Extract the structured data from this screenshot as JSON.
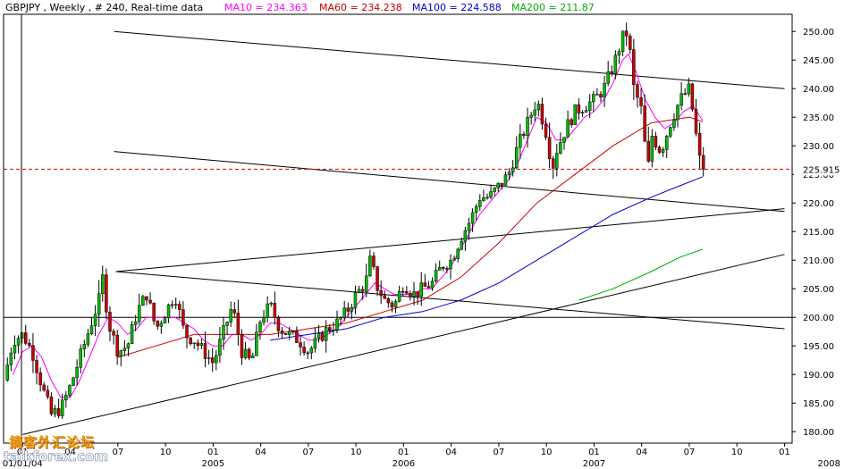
{
  "header": {
    "symbol_info": "GBPJPY , Weekly , # 240, Real-time data",
    "ma10": "MA10 = 234.363",
    "ma60": "MA60 = 234.238",
    "ma100": "MA100 = 224.588",
    "ma200": "MA200 = 211.87"
  },
  "last_price_label": "225.915",
  "watermark": {
    "chinese": "摘客外汇论坛",
    "english": "taikforex.com"
  },
  "colors": {
    "ma10": "#ff00ff",
    "ma60": "#cc0000",
    "ma100": "#0000cc",
    "ma200": "#00aa00",
    "bull_candle": "#00bb00",
    "bear_candle": "#cc0000",
    "last_price": "#dd0000"
  },
  "chart_data": {
    "type": "candlestick",
    "title": "GBPJPY , Weekly , # 240, Real-time data",
    "ylim": [
      178,
      253
    ],
    "y_ticks": [
      180,
      185,
      190,
      195,
      200,
      205,
      210,
      215,
      220,
      225,
      230,
      235,
      240,
      245,
      250
    ],
    "x_tick_labels": [
      "01",
      "04",
      "07",
      "10",
      "01",
      "04",
      "07",
      "10",
      "01",
      "04",
      "07",
      "10",
      "01",
      "04",
      "07",
      "10",
      "01"
    ],
    "year_labels": [
      "01/01/04",
      "2005",
      "2006",
      "2007",
      "2008"
    ],
    "horizontal_lines": [
      {
        "value": 200.0,
        "style": "solid"
      },
      {
        "value": 225.915,
        "style": "dashed",
        "label": "225.915"
      }
    ],
    "anchors": [
      [
        2003.92,
        189
      ],
      [
        2003.97,
        196
      ],
      [
        2004.02,
        197
      ],
      [
        2004.07,
        194
      ],
      [
        2004.12,
        188
      ],
      [
        2004.17,
        183
      ],
      [
        2004.22,
        184
      ],
      [
        2004.27,
        188
      ],
      [
        2004.32,
        193
      ],
      [
        2004.37,
        198
      ],
      [
        2004.42,
        203
      ],
      [
        2004.44,
        207
      ],
      [
        2004.47,
        199
      ],
      [
        2004.52,
        194
      ],
      [
        2004.57,
        195
      ],
      [
        2004.62,
        201
      ],
      [
        2004.67,
        204
      ],
      [
        2004.72,
        198
      ],
      [
        2004.77,
        201
      ],
      [
        2004.82,
        204
      ],
      [
        2004.87,
        197
      ],
      [
        2004.92,
        196
      ],
      [
        2004.97,
        194
      ],
      [
        2005.02,
        192
      ],
      [
        2005.07,
        197
      ],
      [
        2005.12,
        202
      ],
      [
        2005.17,
        194
      ],
      [
        2005.22,
        192
      ],
      [
        2005.27,
        200
      ],
      [
        2005.32,
        202
      ],
      [
        2005.37,
        198
      ],
      [
        2005.42,
        197
      ],
      [
        2005.47,
        196
      ],
      [
        2005.52,
        194
      ],
      [
        2005.57,
        196
      ],
      [
        2005.62,
        198
      ],
      [
        2005.67,
        199
      ],
      [
        2005.72,
        201
      ],
      [
        2005.77,
        204
      ],
      [
        2005.82,
        206
      ],
      [
        2005.85,
        211
      ],
      [
        2005.87,
        206
      ],
      [
        2005.92,
        203
      ],
      [
        2005.97,
        202
      ],
      [
        2006.02,
        206
      ],
      [
        2006.07,
        204
      ],
      [
        2006.12,
        205
      ],
      [
        2006.17,
        206
      ],
      [
        2006.22,
        209
      ],
      [
        2006.27,
        210
      ],
      [
        2006.32,
        214
      ],
      [
        2006.37,
        217
      ],
      [
        2006.42,
        221
      ],
      [
        2006.47,
        221
      ],
      [
        2006.52,
        223
      ],
      [
        2006.57,
        225
      ],
      [
        2006.62,
        230
      ],
      [
        2006.67,
        234
      ],
      [
        2006.72,
        238
      ],
      [
        2006.77,
        232
      ],
      [
        2006.8,
        226
      ],
      [
        2006.82,
        229
      ],
      [
        2006.87,
        233
      ],
      [
        2006.92,
        236
      ],
      [
        2006.97,
        237
      ],
      [
        2007.02,
        238
      ],
      [
        2007.07,
        240
      ],
      [
        2007.12,
        244
      ],
      [
        2007.17,
        249
      ],
      [
        2007.2,
        250
      ],
      [
        2007.22,
        241
      ],
      [
        2007.27,
        236
      ],
      [
        2007.3,
        225
      ],
      [
        2007.32,
        232
      ],
      [
        2007.37,
        229
      ],
      [
        2007.42,
        234
      ],
      [
        2007.47,
        238
      ],
      [
        2007.52,
        240
      ],
      [
        2007.55,
        233
      ],
      [
        2007.57,
        228
      ],
      [
        2007.59,
        226
      ]
    ],
    "series": [
      {
        "name": "MA10",
        "value": 234.363,
        "points": [
          [
            2003.95,
            190
          ],
          [
            2004.0,
            194
          ],
          [
            2004.05,
            195
          ],
          [
            2004.1,
            193
          ],
          [
            2004.15,
            189
          ],
          [
            2004.2,
            186
          ],
          [
            2004.25,
            186
          ],
          [
            2004.3,
            189
          ],
          [
            2004.35,
            193
          ],
          [
            2004.4,
            197
          ],
          [
            2004.45,
            200
          ],
          [
            2004.5,
            199
          ],
          [
            2004.55,
            197
          ],
          [
            2004.6,
            198
          ],
          [
            2004.65,
            200
          ],
          [
            2004.7,
            200
          ],
          [
            2004.75,
            200
          ],
          [
            2004.8,
            200
          ],
          [
            2004.85,
            199
          ],
          [
            2004.9,
            198
          ],
          [
            2004.95,
            196
          ],
          [
            2005.0,
            195
          ],
          [
            2005.05,
            195
          ],
          [
            2005.1,
            197
          ],
          [
            2005.15,
            197
          ],
          [
            2005.2,
            196
          ],
          [
            2005.25,
            197
          ],
          [
            2005.3,
            199
          ],
          [
            2005.35,
            199
          ],
          [
            2005.4,
            198
          ],
          [
            2005.45,
            197
          ],
          [
            2005.5,
            196
          ],
          [
            2005.55,
            196
          ],
          [
            2005.6,
            197
          ],
          [
            2005.65,
            198
          ],
          [
            2005.7,
            200
          ],
          [
            2005.75,
            202
          ],
          [
            2005.8,
            204
          ],
          [
            2005.85,
            206
          ],
          [
            2005.9,
            205
          ],
          [
            2005.95,
            204
          ],
          [
            2006.0,
            204
          ],
          [
            2006.05,
            204
          ],
          [
            2006.1,
            205
          ],
          [
            2006.15,
            205
          ],
          [
            2006.2,
            207
          ],
          [
            2006.25,
            209
          ],
          [
            2006.3,
            212
          ],
          [
            2006.35,
            215
          ],
          [
            2006.4,
            218
          ],
          [
            2006.45,
            220
          ],
          [
            2006.5,
            222
          ],
          [
            2006.55,
            224
          ],
          [
            2006.6,
            227
          ],
          [
            2006.65,
            231
          ],
          [
            2006.7,
            235
          ],
          [
            2006.75,
            234
          ],
          [
            2006.8,
            231
          ],
          [
            2006.85,
            231
          ],
          [
            2006.9,
            233
          ],
          [
            2006.95,
            235
          ],
          [
            2007.0,
            236
          ],
          [
            2007.05,
            238
          ],
          [
            2007.1,
            241
          ],
          [
            2007.15,
            245
          ],
          [
            2007.18,
            246
          ],
          [
            2007.22,
            243
          ],
          [
            2007.27,
            238
          ],
          [
            2007.32,
            235
          ],
          [
            2007.37,
            233
          ],
          [
            2007.42,
            234
          ],
          [
            2007.47,
            236
          ],
          [
            2007.52,
            237
          ],
          [
            2007.57,
            234.4
          ]
        ]
      },
      {
        "name": "MA60",
        "value": 234.238,
        "points": [
          [
            2004.5,
            193
          ],
          [
            2004.7,
            195
          ],
          [
            2004.9,
            197
          ],
          [
            2005.1,
            197
          ],
          [
            2005.3,
            197
          ],
          [
            2005.5,
            198
          ],
          [
            2005.7,
            199
          ],
          [
            2005.9,
            201
          ],
          [
            2006.1,
            203
          ],
          [
            2006.3,
            207
          ],
          [
            2006.5,
            213
          ],
          [
            2006.7,
            220
          ],
          [
            2006.9,
            225
          ],
          [
            2007.1,
            230
          ],
          [
            2007.3,
            234
          ],
          [
            2007.5,
            235
          ],
          [
            2007.57,
            234.2
          ]
        ]
      },
      {
        "name": "MA100",
        "value": 224.588,
        "points": [
          [
            2005.3,
            196
          ],
          [
            2005.5,
            197
          ],
          [
            2005.7,
            198
          ],
          [
            2005.9,
            200
          ],
          [
            2006.1,
            201
          ],
          [
            2006.3,
            203
          ],
          [
            2006.5,
            206
          ],
          [
            2006.7,
            210
          ],
          [
            2006.9,
            214
          ],
          [
            2007.1,
            218
          ],
          [
            2007.3,
            221
          ],
          [
            2007.45,
            223
          ],
          [
            2007.57,
            224.6
          ]
        ]
      },
      {
        "name": "MA200",
        "value": 211.87,
        "points": [
          [
            2006.92,
            203
          ],
          [
            2007.1,
            205
          ],
          [
            2007.3,
            208
          ],
          [
            2007.45,
            210.5
          ],
          [
            2007.57,
            211.9
          ]
        ]
      }
    ],
    "trendlines": [
      {
        "from": [
          2004.48,
          250.0
        ],
        "to": [
          2008.0,
          240.0
        ]
      },
      {
        "from": [
          2004.48,
          229.0
        ],
        "to": [
          2008.0,
          218.5
        ]
      },
      {
        "from": [
          2004.49,
          208.0
        ],
        "to": [
          2008.0,
          198.0
        ]
      },
      {
        "from": [
          2004.49,
          208.0
        ],
        "to": [
          2008.0,
          219.0
        ]
      },
      {
        "from": [
          2004.0,
          179.5
        ],
        "to": [
          2008.0,
          211.0
        ]
      }
    ]
  }
}
